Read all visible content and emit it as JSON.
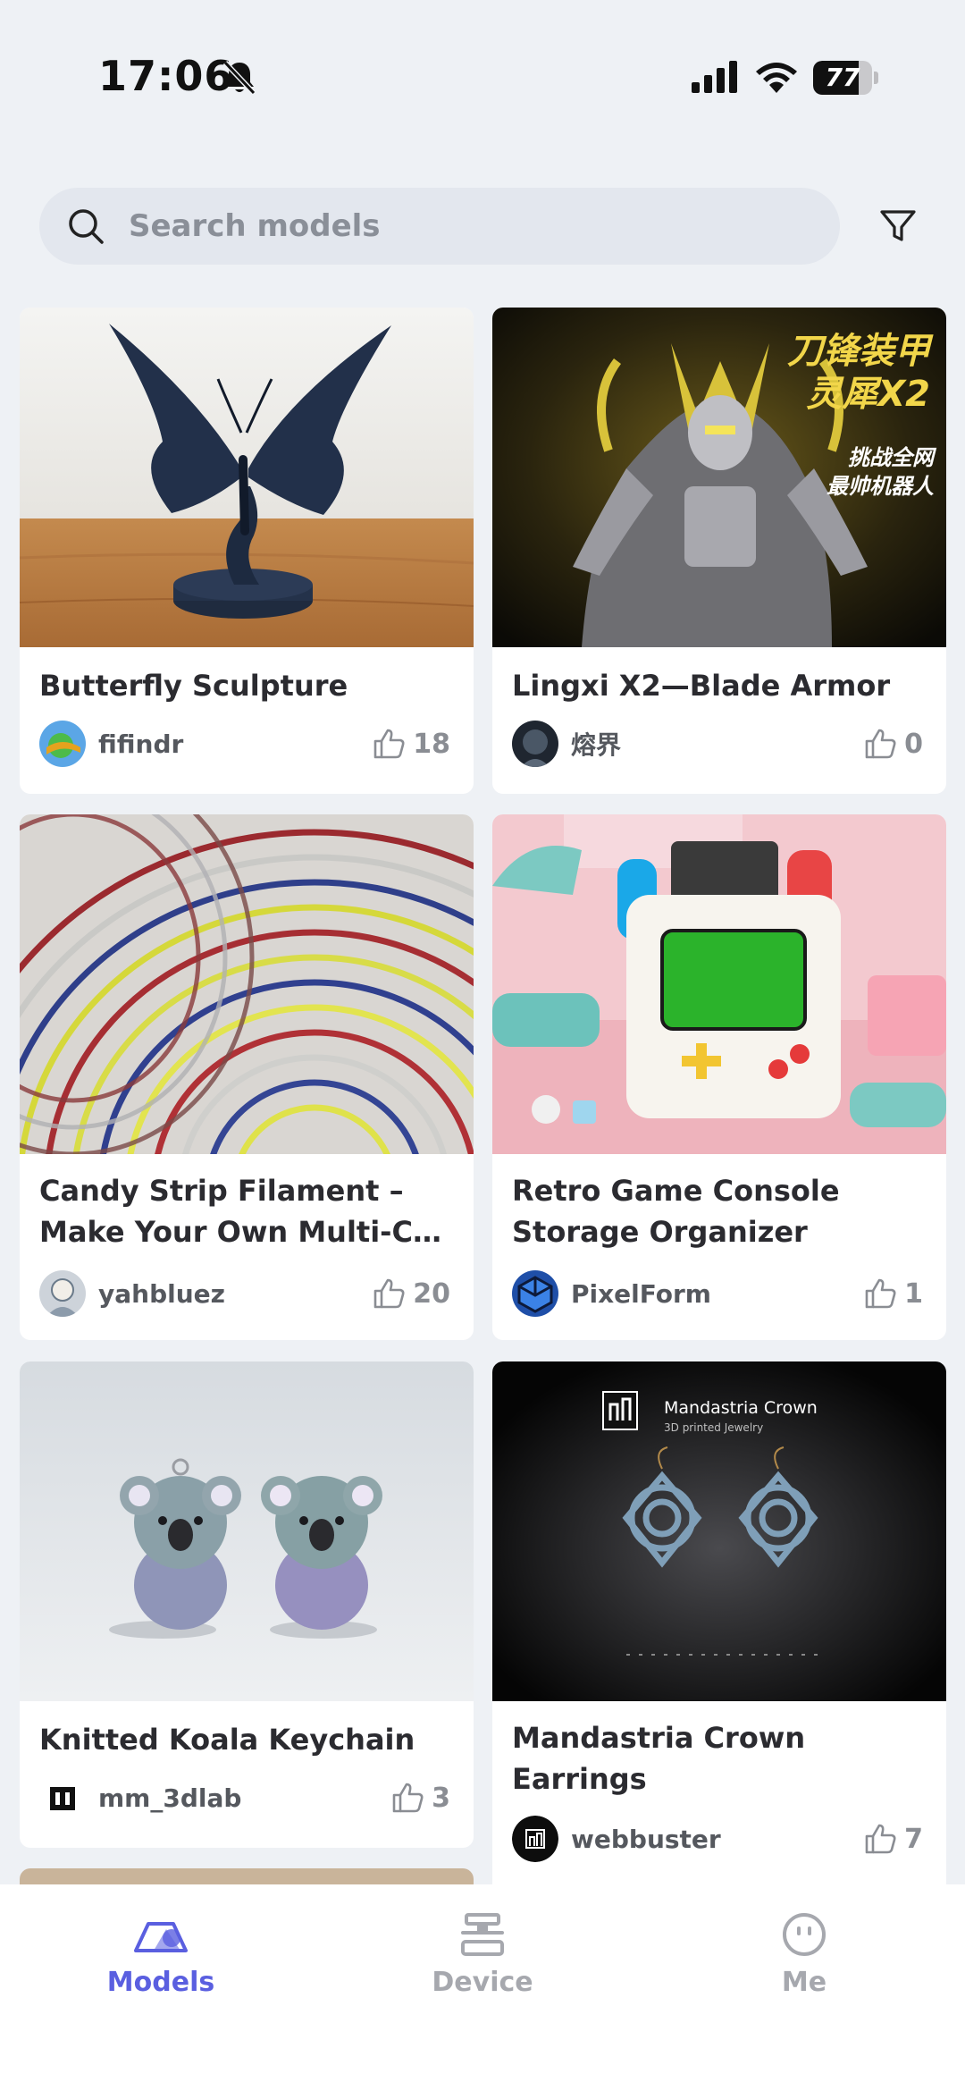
{
  "status_bar": {
    "time": "17:06",
    "battery": "77",
    "battery_level": 0.77,
    "icons": [
      "bell-muted-icon",
      "cellular-signal-icon",
      "wifi-icon",
      "battery-icon"
    ]
  },
  "search": {
    "placeholder": "Search models",
    "value": ""
  },
  "models": [
    {
      "title": "Butterfly Sculpture",
      "author": "fifindr",
      "likes": "18",
      "image": "butterfly-sculpture-photo"
    },
    {
      "title": "Lingxi X2—Blade Armor",
      "author": "熔界",
      "likes": "0",
      "image": "blade-armor-robot-photo",
      "image_text": [
        "刀锋装甲",
        "灵犀X2",
        "挑战全网",
        "最帅机器人"
      ]
    },
    {
      "title": "Candy Strip Filament – Make Your Own Multi-C…",
      "author": "yahbluez",
      "likes": "20",
      "image": "candy-strip-filament-photo"
    },
    {
      "title": "Retro Game Console Storage Organizer",
      "author": "PixelForm",
      "likes": "1",
      "image": "retro-game-console-photo"
    },
    {
      "title": "Knitted Koala Keychain",
      "author": "mm_3dlab",
      "likes": "3",
      "image": "knitted-koala-photo"
    },
    {
      "title": "Mandastria Crown Earrings",
      "author": "webbuster",
      "likes": "7",
      "image": "mandastria-earrings-photo",
      "image_text": [
        "Mandastria Crown",
        "3D printed Jewelry"
      ]
    }
  ],
  "nav": {
    "items": [
      {
        "label": "Models",
        "icon": "models-icon",
        "active": true
      },
      {
        "label": "Device",
        "icon": "printer-icon",
        "active": false
      },
      {
        "label": "Me",
        "icon": "smiley-icon",
        "active": false
      }
    ]
  },
  "colors": {
    "accent": "#5a5fe0",
    "background": "#eef1f5",
    "card": "#ffffff",
    "inactive": "#a6a8ae"
  }
}
